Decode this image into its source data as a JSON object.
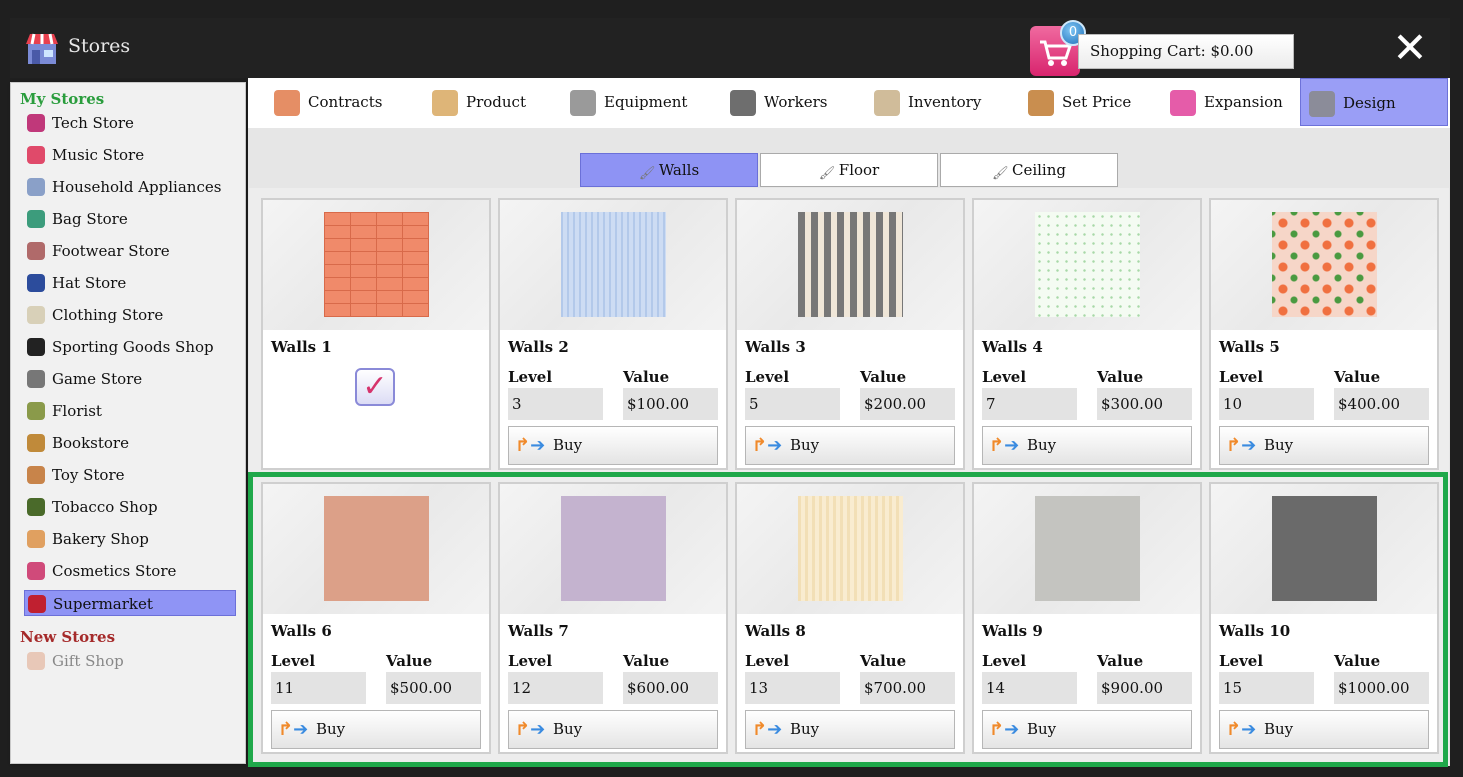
{
  "window": {
    "title": "Stores",
    "close_label": "✕"
  },
  "cart": {
    "count": "0",
    "label": "Shopping Cart: $0.00"
  },
  "sidebar": {
    "my_stores_title": "My Stores",
    "new_stores_title": "New Stores",
    "my_stores": [
      {
        "label": "Tech Store",
        "icon": "tech-icon"
      },
      {
        "label": "Music Store",
        "icon": "music-icon"
      },
      {
        "label": "Household Appliances",
        "icon": "appliance-icon"
      },
      {
        "label": "Bag Store",
        "icon": "bag-icon"
      },
      {
        "label": "Footwear Store",
        "icon": "shoe-icon"
      },
      {
        "label": "Hat Store",
        "icon": "hat-icon"
      },
      {
        "label": "Clothing Store",
        "icon": "shirt-icon"
      },
      {
        "label": "Sporting Goods Shop",
        "icon": "ball-icon"
      },
      {
        "label": "Game Store",
        "icon": "gamepad-icon"
      },
      {
        "label": "Florist",
        "icon": "plant-icon"
      },
      {
        "label": "Bookstore",
        "icon": "book-icon"
      },
      {
        "label": "Toy Store",
        "icon": "teddy-icon"
      },
      {
        "label": "Tobacco Shop",
        "icon": "tobacco-icon"
      },
      {
        "label": "Bakery Shop",
        "icon": "bread-icon"
      },
      {
        "label": "Cosmetics Store",
        "icon": "cosmetics-icon"
      },
      {
        "label": "Supermarket",
        "icon": "basket-icon",
        "active": true
      }
    ],
    "new_stores": [
      {
        "label": "Gift Shop",
        "icon": "gift-icon"
      }
    ]
  },
  "tabs": [
    {
      "label": "Contracts",
      "icon": "contract-icon"
    },
    {
      "label": "Product",
      "icon": "box-icon"
    },
    {
      "label": "Equipment",
      "icon": "shelf-icon"
    },
    {
      "label": "Workers",
      "icon": "worker-icon"
    },
    {
      "label": "Inventory",
      "icon": "inventory-icon"
    },
    {
      "label": "Set Price",
      "icon": "price-tag-icon"
    },
    {
      "label": "Expansion",
      "icon": "expand-icon"
    },
    {
      "label": "Design",
      "icon": "brush-icon",
      "active": true
    }
  ],
  "subtabs": [
    {
      "label": "Walls",
      "active": true
    },
    {
      "label": "Floor"
    },
    {
      "label": "Ceiling"
    }
  ],
  "labels": {
    "level": "Level",
    "value": "Value",
    "buy": "Buy"
  },
  "walls": [
    {
      "name": "Walls 1",
      "owned": true,
      "texture": "brick",
      "color": "#f08a6a"
    },
    {
      "name": "Walls 2",
      "level": "3",
      "value": "$100.00",
      "texture": "stripes-blue",
      "color": "#c3d6f0"
    },
    {
      "name": "Walls 3",
      "level": "5",
      "value": "$200.00",
      "texture": "stripes-gray",
      "color": "#8f8f8f"
    },
    {
      "name": "Walls 4",
      "level": "7",
      "value": "$300.00",
      "texture": "dots-green",
      "color": "#f4fbf2"
    },
    {
      "name": "Walls 5",
      "level": "10",
      "value": "$400.00",
      "texture": "fruit",
      "color": "#f6d6c8"
    },
    {
      "name": "Walls 6",
      "level": "11",
      "value": "$500.00",
      "texture": "plain",
      "color": "#dca088"
    },
    {
      "name": "Walls 7",
      "level": "12",
      "value": "$600.00",
      "texture": "plain",
      "color": "#c4b3cf"
    },
    {
      "name": "Walls 8",
      "level": "13",
      "value": "$700.00",
      "texture": "wood",
      "color": "#f7e6c2"
    },
    {
      "name": "Walls 9",
      "level": "14",
      "value": "$900.00",
      "texture": "plain",
      "color": "#c4c4c0"
    },
    {
      "name": "Walls 10",
      "level": "15",
      "value": "$1000.00",
      "texture": "plain",
      "color": "#6a6a6a"
    }
  ]
}
